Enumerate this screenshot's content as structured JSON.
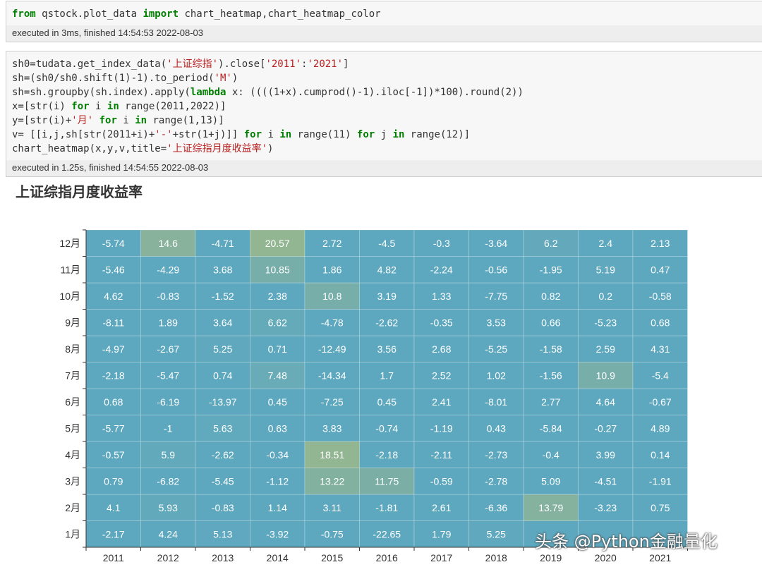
{
  "cells": [
    {
      "code_lines": [
        [
          {
            "t": "from",
            "c": "kw"
          },
          {
            "t": " qstock.plot_data "
          },
          {
            "t": "import",
            "c": "kw"
          },
          {
            "t": " chart_heatmap,chart_heatmap_color"
          }
        ]
      ],
      "exec_status": "executed in 3ms, finished 14:54:53 2022-08-03"
    },
    {
      "code_lines": [
        [
          {
            "t": "sh0=tudata.get_index_data("
          },
          {
            "t": "'上证综指'",
            "c": "str"
          },
          {
            "t": ").close["
          },
          {
            "t": "'2011'",
            "c": "str"
          },
          {
            "t": ":"
          },
          {
            "t": "'2021'",
            "c": "str"
          },
          {
            "t": "]"
          }
        ],
        [
          {
            "t": "sh=(sh0/sh0.shift(1)-1).to_period("
          },
          {
            "t": "'M'",
            "c": "str"
          },
          {
            "t": ")"
          }
        ],
        [
          {
            "t": "sh=sh.groupby(sh.index).apply("
          },
          {
            "t": "lambda",
            "c": "kw"
          },
          {
            "t": " x: ((((1+x).cumprod()-1).iloc[-1])*100).round(2))"
          }
        ],
        [
          {
            "t": "x=[str(i) "
          },
          {
            "t": "for",
            "c": "kw"
          },
          {
            "t": " i "
          },
          {
            "t": "in",
            "c": "kw"
          },
          {
            "t": " range(2011,2022)]"
          }
        ],
        [
          {
            "t": "y=[str(i)+"
          },
          {
            "t": "'月'",
            "c": "str"
          },
          {
            "t": " "
          },
          {
            "t": "for",
            "c": "kw"
          },
          {
            "t": " i "
          },
          {
            "t": "in",
            "c": "kw"
          },
          {
            "t": " range(1,13)]"
          }
        ],
        [
          {
            "t": "v= [[i,j,sh[str(2011+i)+"
          },
          {
            "t": "'-'",
            "c": "str"
          },
          {
            "t": "+str(1+j)]] "
          },
          {
            "t": "for",
            "c": "kw"
          },
          {
            "t": " i "
          },
          {
            "t": "in",
            "c": "kw"
          },
          {
            "t": " range(11) "
          },
          {
            "t": "for",
            "c": "kw"
          },
          {
            "t": " j "
          },
          {
            "t": "in",
            "c": "kw"
          },
          {
            "t": " range(12)]"
          }
        ],
        [
          {
            "t": "chart_heatmap(x,y,v,title="
          },
          {
            "t": "'上证综指月度收益率'",
            "c": "str"
          },
          {
            "t": ")"
          }
        ]
      ],
      "exec_status": "executed in 1.25s, finished 14:54:55 2022-08-03"
    }
  ],
  "colors": {
    "base": "#5ea8bf",
    "high": "#92b592",
    "text": "#ffffff"
  },
  "watermark": "头条 @Python金融量化",
  "chart_data": {
    "type": "heatmap",
    "title": "上证综指月度收益率",
    "x": [
      "2011",
      "2012",
      "2013",
      "2014",
      "2015",
      "2016",
      "2017",
      "2018",
      "2019",
      "2020",
      "2021"
    ],
    "y": [
      "1月",
      "2月",
      "3月",
      "4月",
      "5月",
      "6月",
      "7月",
      "8月",
      "9月",
      "10月",
      "11月",
      "12月"
    ],
    "values": [
      [
        -2.17,
        4.1,
        0.79,
        -0.57,
        -5.77,
        0.68,
        -2.18,
        -4.97,
        -8.11,
        4.62,
        -5.46,
        -5.74
      ],
      [
        4.24,
        5.93,
        -6.82,
        5.9,
        -1,
        -6.19,
        -5.47,
        -2.67,
        1.89,
        -0.83,
        -4.29,
        14.6
      ],
      [
        5.13,
        -0.83,
        -5.45,
        -2.62,
        5.63,
        -13.97,
        0.74,
        5.25,
        3.64,
        -1.52,
        3.68,
        -4.71
      ],
      [
        -3.92,
        1.14,
        -1.12,
        -0.34,
        0.63,
        0.45,
        7.48,
        0.71,
        6.62,
        2.38,
        10.85,
        20.57
      ],
      [
        -0.75,
        3.11,
        13.22,
        18.51,
        3.83,
        -7.25,
        -14.34,
        -12.49,
        -4.78,
        10.8,
        1.86,
        2.72
      ],
      [
        -22.65,
        -1.81,
        11.75,
        -2.18,
        -0.74,
        0.45,
        1.7,
        3.56,
        -2.62,
        3.19,
        4.82,
        -4.5
      ],
      [
        1.79,
        2.61,
        -0.59,
        -2.11,
        -1.19,
        2.41,
        2.52,
        2.68,
        -0.35,
        1.33,
        -2.24,
        -0.3
      ],
      [
        5.25,
        -6.36,
        -2.78,
        -2.73,
        0.43,
        -8.01,
        1.02,
        -5.25,
        3.53,
        -7.75,
        -0.56,
        -3.64
      ],
      [
        null,
        13.79,
        5.09,
        -0.4,
        -5.84,
        2.77,
        -1.56,
        -1.58,
        0.66,
        0.82,
        -1.95,
        6.2
      ],
      [
        null,
        -3.23,
        -4.51,
        3.99,
        -0.27,
        4.64,
        10.9,
        2.59,
        -5.23,
        0.2,
        5.19,
        2.4
      ],
      [
        null,
        0.75,
        -1.91,
        0.14,
        4.89,
        -0.67,
        -5.4,
        4.31,
        0.68,
        -0.58,
        0.47,
        2.13
      ]
    ]
  }
}
